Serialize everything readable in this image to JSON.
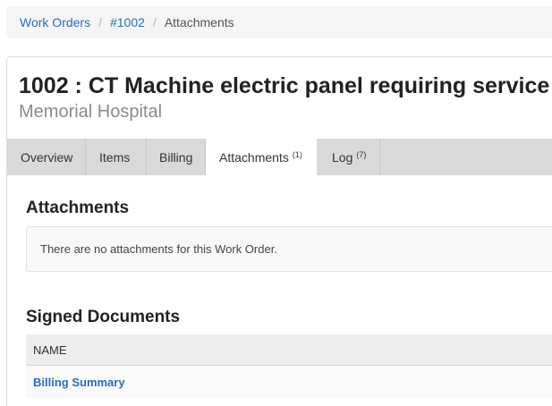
{
  "breadcrumb": {
    "items": [
      "Work Orders",
      "#1002"
    ],
    "separator": "/",
    "current": "Attachments"
  },
  "header": {
    "title": "1002 : CT Machine electric panel requiring service",
    "subtitle": "Memorial Hospital"
  },
  "tabs": [
    {
      "label": "Overview",
      "count": ""
    },
    {
      "label": "Items",
      "count": ""
    },
    {
      "label": "Billing",
      "count": ""
    },
    {
      "label": "Attachments",
      "count": "(1)",
      "active": true
    },
    {
      "label": "Log",
      "count": "(7)"
    }
  ],
  "attachments": {
    "heading": "Attachments",
    "empty_message": "There are no attachments for this Work Order."
  },
  "signed_documents": {
    "heading": "Signed Documents",
    "columns": [
      "NAME"
    ],
    "rows": [
      {
        "name": "Billing Summary"
      }
    ]
  },
  "colors": {
    "link": "#2a6ebb",
    "tabbar": "#d9d9d9",
    "subtitle": "#8a8a8a"
  }
}
